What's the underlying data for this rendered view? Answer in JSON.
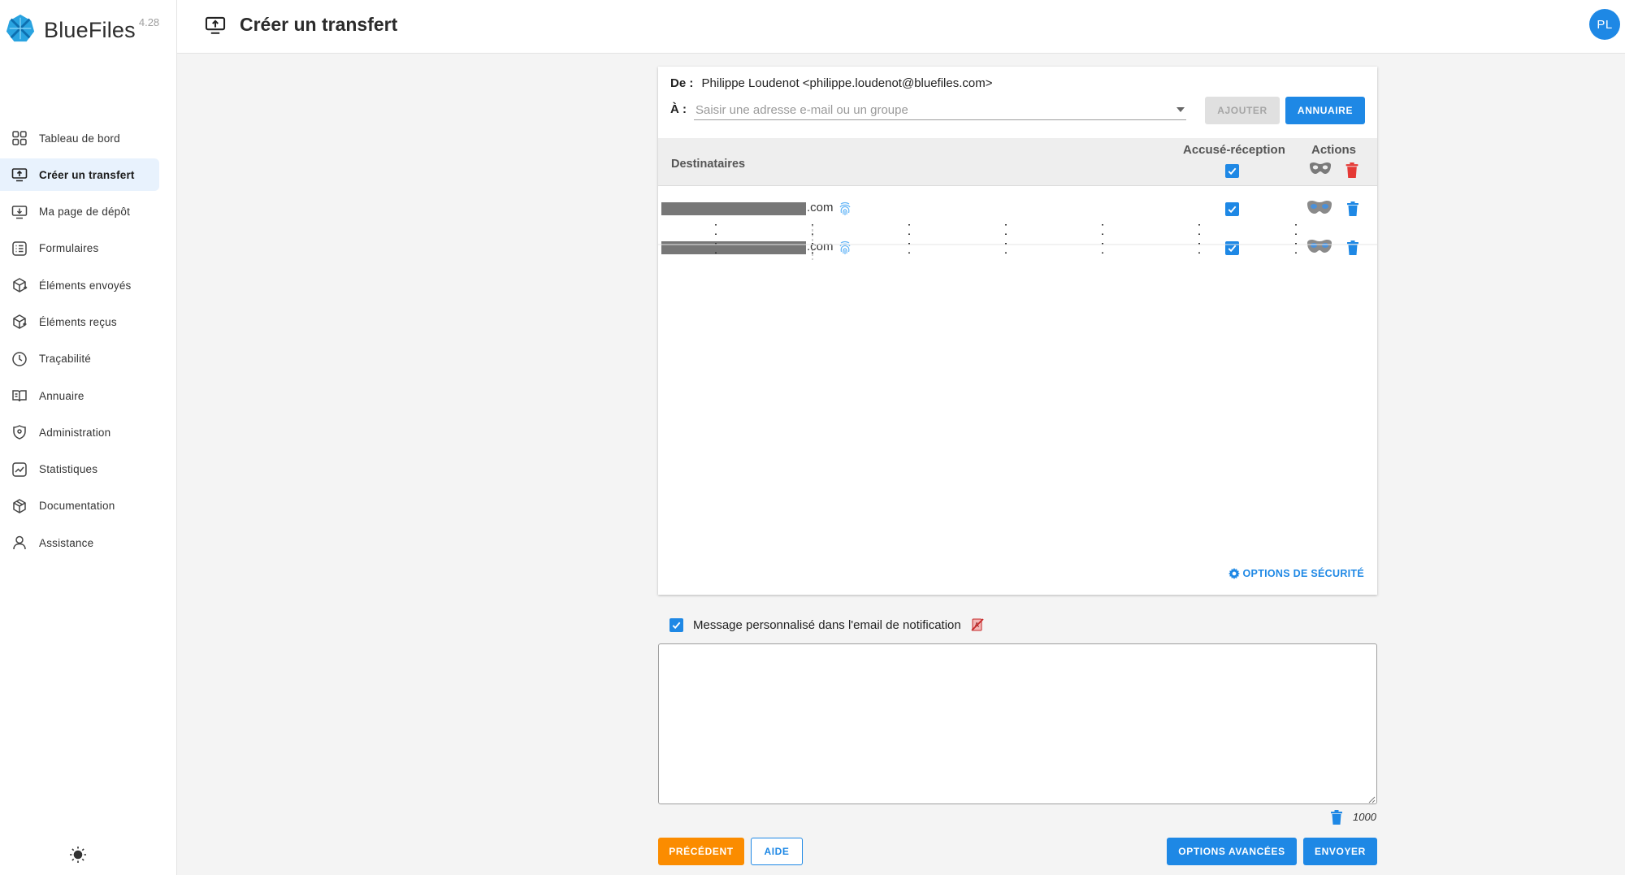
{
  "app": {
    "name": "BlueFiles",
    "version": "4.28"
  },
  "sidebar": {
    "items": [
      {
        "label": "Tableau de bord",
        "icon": "dashboard-icon"
      },
      {
        "label": "Créer un transfert",
        "icon": "upload-screen-icon",
        "active": true
      },
      {
        "label": "Ma page de dépôt",
        "icon": "download-screen-icon"
      },
      {
        "label": "Formulaires",
        "icon": "form-list-icon"
      },
      {
        "label": "Éléments envoyés",
        "icon": "box-out-icon"
      },
      {
        "label": "Éléments reçus",
        "icon": "box-in-icon"
      },
      {
        "label": "Traçabilité",
        "icon": "clock-icon"
      },
      {
        "label": "Annuaire",
        "icon": "book-icon"
      },
      {
        "label": "Administration",
        "icon": "shield-icon"
      },
      {
        "label": "Statistiques",
        "icon": "chart-icon"
      },
      {
        "label": "Documentation",
        "icon": "cube-icon"
      },
      {
        "label": "Assistance",
        "icon": "person-icon"
      }
    ]
  },
  "header": {
    "title": "Créer un transfert",
    "avatar": "PL"
  },
  "form": {
    "from_label": "De :",
    "from_value": "Philippe Loudenot <philippe.loudenot@bluefiles.com>",
    "to_label": "À :",
    "to_placeholder": "Saisir une adresse e-mail ou un groupe",
    "add_label": "AJOUTER",
    "directory_label": "ANNUAIRE"
  },
  "recipients": {
    "col_recipients": "Destinataires",
    "col_ack": "Accusé-réception",
    "col_actions": "Actions",
    "rows": [
      {
        "email_suffix": ".com",
        "ack": true
      },
      {
        "email_suffix": ".com",
        "ack": true
      }
    ]
  },
  "security_options_label": "OPTIONS DE SÉCURITÉ",
  "message": {
    "checkbox_label": "Message personnalisé dans l'email de notification",
    "checked": true,
    "value": "",
    "counter": "1000"
  },
  "footer": {
    "prev_label": "PRÉCÉDENT",
    "help_label": "AIDE",
    "advanced_label": "OPTIONS AVANCÉES",
    "send_label": "ENVOYER"
  },
  "colors": {
    "primary": "#1e88e5",
    "orange": "#fb8c00",
    "danger": "#e53935",
    "active_bg": "#e8f2fd"
  }
}
